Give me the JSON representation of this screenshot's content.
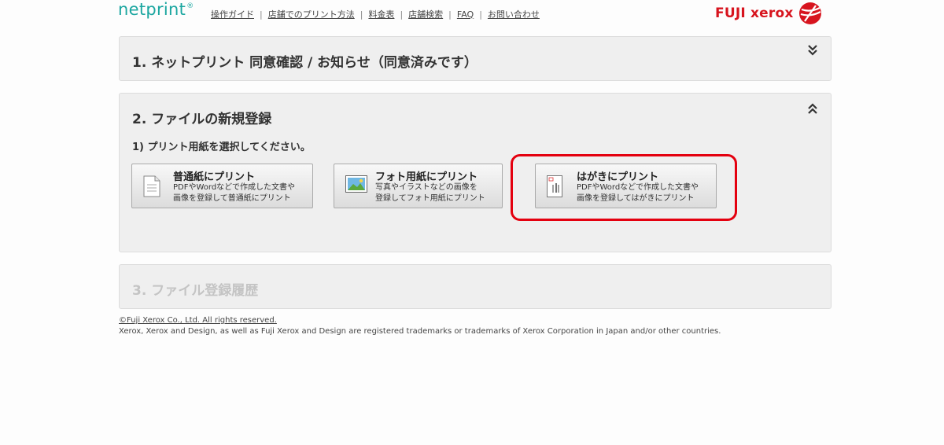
{
  "header": {
    "logo_text": "netprint",
    "logo_mark": "®",
    "nav": [
      {
        "label": "操作ガイド"
      },
      {
        "label": "店舗でのプリント方法"
      },
      {
        "label": "料金表"
      },
      {
        "label": "店舗検索"
      },
      {
        "label": "FAQ"
      },
      {
        "label": "お問い合わせ"
      }
    ],
    "separator": "|",
    "brand": "FUJI xerox",
    "brand_icon": "fuji-xerox-ball-logo"
  },
  "sections": [
    {
      "title": "1. ネットプリント 同意確認 / お知らせ（同意済みです）",
      "toggle_icon": "chevron-double-down-icon"
    },
    {
      "title": "2. ファイルの新規登録",
      "toggle_icon": "chevron-double-up-icon",
      "step_title": "1) プリント用紙を選択してください。",
      "options": [
        {
          "title": "普通紙にプリント",
          "desc1": "PDFやWordなどで作成した文書や",
          "desc2": "画像を登録して普通紙にプリント",
          "icon": "document-icon"
        },
        {
          "title": "フォト用紙にプリント",
          "desc1": "写真やイラストなどの画像を",
          "desc2": "登録してフォト用紙にプリント",
          "icon": "photo-icon"
        },
        {
          "title": "はがきにプリント",
          "desc1": "PDFやWordなどで作成した文書や",
          "desc2": "画像を登録してはがきにプリント",
          "icon": "postcard-icon"
        }
      ]
    },
    {
      "title": "3. ファイル登録履歴"
    }
  ],
  "colors": {
    "highlight": "#e4000f",
    "logo": "#1ba6a0",
    "brand": "#d7141e"
  },
  "footer": {
    "copyright": "©Fuji Xerox Co., Ltd. All rights reserved.",
    "trademark": "Xerox, Xerox and Design, as well as Fuji Xerox and Design are registered trademarks or trademarks of Xerox Corporation in Japan and/or other countries."
  }
}
